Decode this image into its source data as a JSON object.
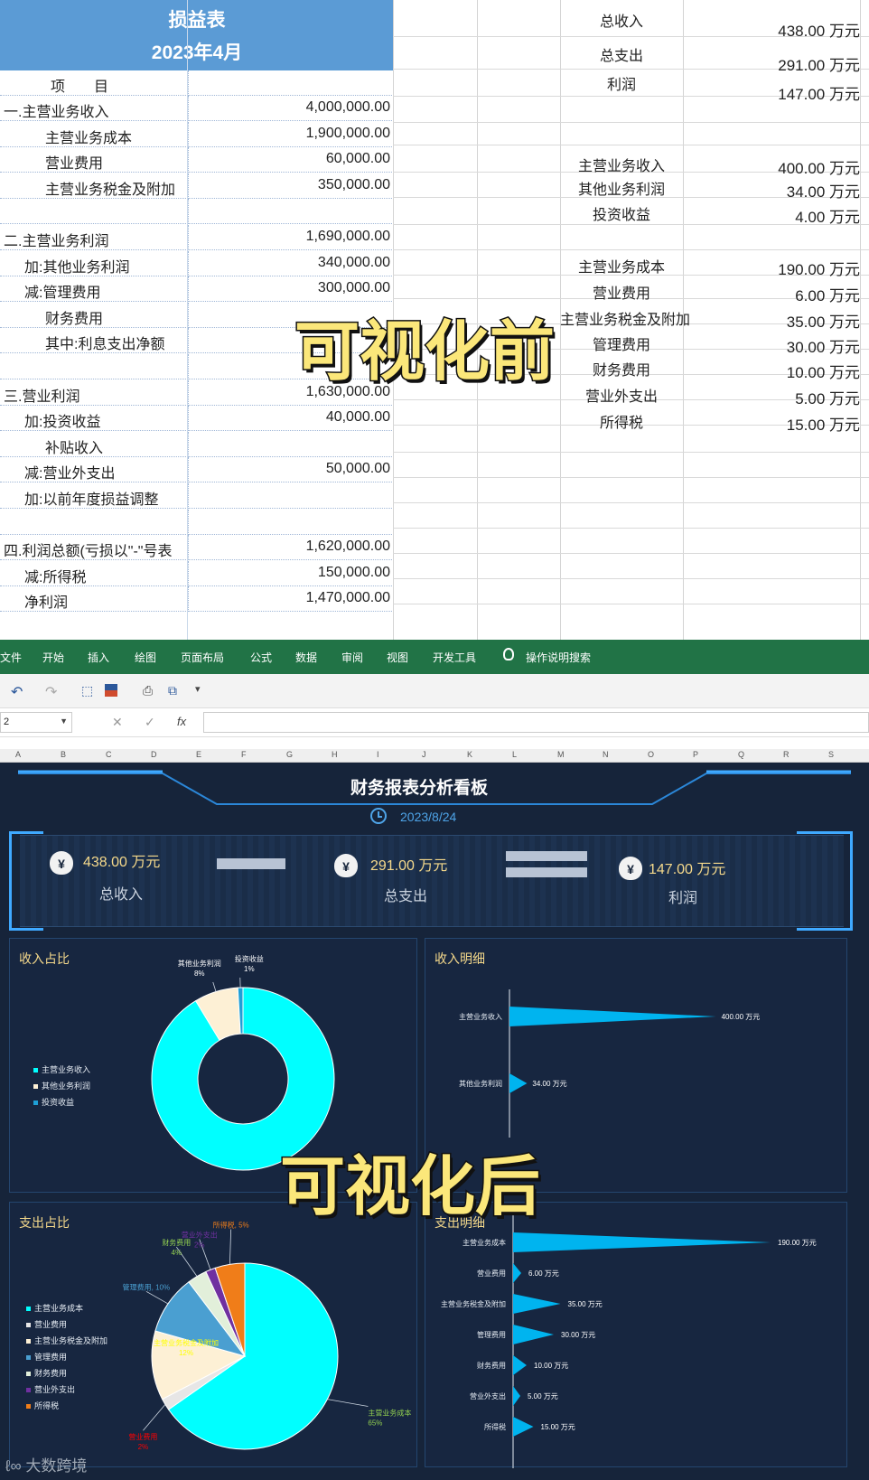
{
  "sheet": {
    "title": "损益表",
    "period": "2023年4月",
    "col_header": "项　　目",
    "rows": [
      {
        "label": "一.主营业务收入",
        "value": "4,000,000.00",
        "indent": 0
      },
      {
        "label": "主营业务成本",
        "value": "1,900,000.00",
        "indent": 2
      },
      {
        "label": "营业费用",
        "value": "60,000.00",
        "indent": 2
      },
      {
        "label": "主营业务税金及附加",
        "value": "350,000.00",
        "indent": 2
      },
      {
        "label": "",
        "value": "",
        "indent": 0
      },
      {
        "label": "二.主营业务利润",
        "value": "1,690,000.00",
        "indent": 0
      },
      {
        "label": "加:其他业务利润",
        "value": "340,000.00",
        "indent": 1
      },
      {
        "label": "减:管理费用",
        "value": "300,000.00",
        "indent": 1
      },
      {
        "label": "财务费用",
        "value": "",
        "indent": 2
      },
      {
        "label": "其中:利息支出净额",
        "value": "",
        "indent": 2
      },
      {
        "label": "",
        "value": "",
        "indent": 0
      },
      {
        "label": "三.营业利润",
        "value": "1,630,000.00",
        "indent": 0
      },
      {
        "label": "加:投资收益",
        "value": "40,000.00",
        "indent": 1
      },
      {
        "label": "补贴收入",
        "value": "",
        "indent": 2
      },
      {
        "label": "减:营业外支出",
        "value": "50,000.00",
        "indent": 1
      },
      {
        "label": "加:以前年度损益调整",
        "value": "",
        "indent": 1
      },
      {
        "label": "",
        "value": "",
        "indent": 0
      },
      {
        "label": "四.利润总额(亏损以\"-\"号表",
        "value": "1,620,000.00",
        "indent": 0
      },
      {
        "label": "减:所得税",
        "value": "150,000.00",
        "indent": 1
      },
      {
        "label": "净利润",
        "value": "1,470,000.00",
        "indent": 1
      }
    ],
    "summary": [
      {
        "label": "总收入",
        "value": "438.00 万元"
      },
      {
        "label": "总支出",
        "value": "291.00 万元"
      },
      {
        "label": "利润",
        "value": "147.00 万元"
      }
    ],
    "details": [
      {
        "label": "主营业务收入",
        "value": "400.00 万元"
      },
      {
        "label": "其他业务利润",
        "value": "34.00 万元"
      },
      {
        "label": "投资收益",
        "value": "4.00 万元"
      },
      {
        "label": "主营业务成本",
        "value": "190.00 万元"
      },
      {
        "label": "营业费用",
        "value": "6.00 万元"
      },
      {
        "label": "主营业务税金及附加",
        "value": "35.00 万元"
      },
      {
        "label": "管理费用",
        "value": "30.00 万元"
      },
      {
        "label": "财务费用",
        "value": "10.00 万元"
      },
      {
        "label": "营业外支出",
        "value": "5.00 万元"
      },
      {
        "label": "所得税",
        "value": "15.00 万元"
      }
    ]
  },
  "overlay_before": "可视化前",
  "overlay_after": "可视化后",
  "ribbon": {
    "tabs": [
      "文件",
      "开始",
      "插入",
      "绘图",
      "页面布局",
      "公式",
      "数据",
      "审阅",
      "视图",
      "开发工具",
      "操作说明搜索"
    ],
    "name_box": "2",
    "fx": "fx",
    "columns": [
      "A",
      "B",
      "C",
      "D",
      "E",
      "F",
      "G",
      "H",
      "I",
      "J",
      "K",
      "L",
      "M",
      "N",
      "O",
      "P",
      "Q",
      "R",
      "S"
    ]
  },
  "dashboard": {
    "title": "财务报表分析看板",
    "date": "2023/8/24",
    "kpis": [
      {
        "value": "438.00 万元",
        "label": "总收入"
      },
      {
        "value": "291.00 万元",
        "label": "总支出"
      },
      {
        "value": "147.00 万元",
        "label": "利润"
      }
    ],
    "panel_income_share": "收入占比",
    "panel_income_detail": "收入明细",
    "panel_expense_share": "支出占比",
    "panel_expense_detail": "支出明细"
  },
  "colors": {
    "dash_bg": "#16243a",
    "accent_gold": "#f5d98b",
    "cyan": "#00ffff",
    "excel_green": "#217346",
    "header_blue": "#5b9bd5"
  },
  "chart_data": [
    {
      "type": "pie",
      "variant": "donut",
      "title": "收入占比",
      "categories": [
        "主营业务收入",
        "其他业务利润",
        "投资收益"
      ],
      "values": [
        400,
        34,
        4
      ],
      "colors": [
        "#00ffff",
        "#fdf0d5",
        "#1e9fd6"
      ],
      "slice_labels": [
        "",
        "其他业务利润\n8%",
        "投资收益\n1%"
      ],
      "legend": "left"
    },
    {
      "type": "bar",
      "orientation": "horizontal",
      "title": "收入明细",
      "categories": [
        "主营业务收入",
        "其他业务利润"
      ],
      "values": [
        400,
        34
      ],
      "value_labels": [
        "400.00 万元",
        "34.00 万元"
      ],
      "xlim": [
        0,
        420
      ]
    },
    {
      "type": "pie",
      "title": "支出占比",
      "categories": [
        "主营业务成本",
        "营业费用",
        "主营业务税金及附加",
        "管理费用",
        "财务费用",
        "营业外支出",
        "所得税"
      ],
      "values": [
        190,
        6,
        35,
        30,
        10,
        5,
        15
      ],
      "colors": [
        "#00ffff",
        "#e7e6e6",
        "#fdf0d5",
        "#4a9fd1",
        "#e2efda",
        "#7030a0",
        "#f07d19"
      ],
      "slice_labels": [
        "主营业务成本\n65%",
        "营业费用\n2%",
        "主营业务税金及附加\n12%",
        "管理费用, 10%",
        "财务费用\n4%",
        "营业外支出\n2%",
        "所得税, 5%"
      ],
      "label_colors": [
        "#92d050",
        "#ff0000",
        "#ffff00",
        "#4a9fd1",
        "#92d050",
        "#7030a0",
        "#f07d19"
      ],
      "legend": "left"
    },
    {
      "type": "bar",
      "orientation": "horizontal",
      "title": "支出明细",
      "categories": [
        "主营业务成本",
        "营业费用",
        "主营业务税金及附加",
        "管理费用",
        "财务费用",
        "营业外支出",
        "所得税"
      ],
      "values": [
        190,
        6,
        35,
        30,
        10,
        5,
        15
      ],
      "value_labels": [
        "190.00 万元",
        "6.00 万元",
        "35.00 万元",
        "30.00 万元",
        "10.00 万元",
        "5.00 万元",
        "15.00 万元"
      ],
      "xlim": [
        0,
        200
      ]
    }
  ],
  "watermark": "大数跨境"
}
